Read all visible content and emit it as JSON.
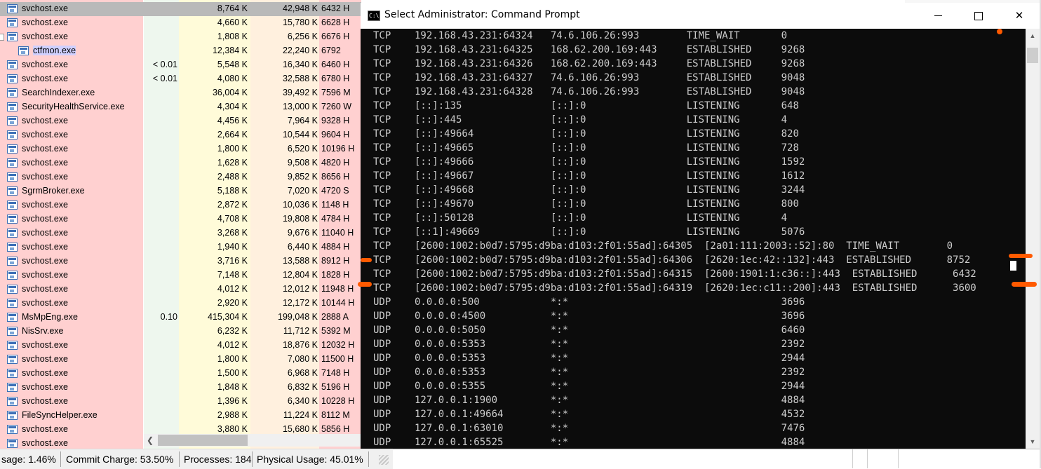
{
  "process_explorer": {
    "rows": [
      {
        "name": "svchost.exe",
        "cpu": "",
        "private": "8,764 K",
        "working": "42,948 K",
        "pid": "6432 H",
        "state": "selected"
      },
      {
        "name": "svchost.exe",
        "cpu": "",
        "private": "4,660 K",
        "working": "15,780 K",
        "pid": "6628 H"
      },
      {
        "name": "svchost.exe",
        "cpu": "",
        "private": "1,808 K",
        "working": "6,256 K",
        "pid": "6676 H",
        "expander": true
      },
      {
        "name": "ctfmon.exe",
        "cpu": "",
        "private": "12,384 K",
        "working": "22,240 K",
        "pid": "6792",
        "child": true,
        "state": "highlight"
      },
      {
        "name": "svchost.exe",
        "cpu": "< 0.01",
        "private": "5,548 K",
        "working": "16,340 K",
        "pid": "6460 H"
      },
      {
        "name": "svchost.exe",
        "cpu": "< 0.01",
        "private": "4,080 K",
        "working": "32,588 K",
        "pid": "6780 H"
      },
      {
        "name": "SearchIndexer.exe",
        "cpu": "",
        "private": "36,004 K",
        "working": "39,492 K",
        "pid": "7596 M"
      },
      {
        "name": "SecurityHealthService.exe",
        "cpu": "",
        "private": "4,304 K",
        "working": "13,000 K",
        "pid": "7260 W"
      },
      {
        "name": "svchost.exe",
        "cpu": "",
        "private": "4,456 K",
        "working": "7,964 K",
        "pid": "9328 H"
      },
      {
        "name": "svchost.exe",
        "cpu": "",
        "private": "2,664 K",
        "working": "10,544 K",
        "pid": "9604 H"
      },
      {
        "name": "svchost.exe",
        "cpu": "",
        "private": "1,800 K",
        "working": "6,520 K",
        "pid": "10196 H"
      },
      {
        "name": "svchost.exe",
        "cpu": "",
        "private": "1,628 K",
        "working": "9,508 K",
        "pid": "4820 H"
      },
      {
        "name": "svchost.exe",
        "cpu": "",
        "private": "2,488 K",
        "working": "9,852 K",
        "pid": "8656 H"
      },
      {
        "name": "SgrmBroker.exe",
        "cpu": "",
        "private": "5,188 K",
        "working": "7,020 K",
        "pid": "4720 S"
      },
      {
        "name": "svchost.exe",
        "cpu": "",
        "private": "2,872 K",
        "working": "10,036 K",
        "pid": "1148 H"
      },
      {
        "name": "svchost.exe",
        "cpu": "",
        "private": "4,708 K",
        "working": "19,808 K",
        "pid": "4784 H"
      },
      {
        "name": "svchost.exe",
        "cpu": "",
        "private": "3,268 K",
        "working": "9,676 K",
        "pid": "11040 H"
      },
      {
        "name": "svchost.exe",
        "cpu": "",
        "private": "1,940 K",
        "working": "6,440 K",
        "pid": "4884 H"
      },
      {
        "name": "svchost.exe",
        "cpu": "",
        "private": "3,716 K",
        "working": "13,588 K",
        "pid": "8912 H"
      },
      {
        "name": "svchost.exe",
        "cpu": "",
        "private": "7,148 K",
        "working": "12,804 K",
        "pid": "1828 H"
      },
      {
        "name": "svchost.exe",
        "cpu": "",
        "private": "4,012 K",
        "working": "12,012 K",
        "pid": "11948 H"
      },
      {
        "name": "svchost.exe",
        "cpu": "",
        "private": "2,920 K",
        "working": "12,172 K",
        "pid": "10144 H"
      },
      {
        "name": "MsMpEng.exe",
        "cpu": "0.10",
        "private": "415,304 K",
        "working": "199,048 K",
        "pid": "2888 A"
      },
      {
        "name": "NisSrv.exe",
        "cpu": "",
        "private": "6,232 K",
        "working": "11,712 K",
        "pid": "5392 M"
      },
      {
        "name": "svchost.exe",
        "cpu": "",
        "private": "4,012 K",
        "working": "18,876 K",
        "pid": "12032 H"
      },
      {
        "name": "svchost.exe",
        "cpu": "",
        "private": "1,800 K",
        "working": "7,080 K",
        "pid": "11500 H"
      },
      {
        "name": "svchost.exe",
        "cpu": "",
        "private": "1,500 K",
        "working": "6,968 K",
        "pid": "7148 H"
      },
      {
        "name": "svchost.exe",
        "cpu": "",
        "private": "1,848 K",
        "working": "6,832 K",
        "pid": "5196 H"
      },
      {
        "name": "svchost.exe",
        "cpu": "",
        "private": "1,396 K",
        "working": "6,340 K",
        "pid": "10228 H"
      },
      {
        "name": "FileSyncHelper.exe",
        "cpu": "",
        "private": "2,988 K",
        "working": "11,224 K",
        "pid": "8112 M"
      },
      {
        "name": "svchost.exe",
        "cpu": "",
        "private": "3,880 K",
        "working": "15,680 K",
        "pid": "5856 H"
      },
      {
        "name": "svchost.exe",
        "cpu": "",
        "private": "",
        "working": "",
        "pid": ""
      }
    ]
  },
  "status_bar": {
    "cpu_usage": "sage: 1.46%",
    "commit_charge": "Commit Charge: 53.50%",
    "processes": "Processes: 184",
    "physical_usage": "Physical Usage: 45.01%"
  },
  "cmd_window": {
    "title": "Select Administrator: Command Prompt",
    "icon_text": "C:\\",
    "controls": {
      "minimize": "minimize",
      "maximize": "maximize",
      "close": "✕"
    },
    "lines": [
      {
        "proto": "TCP",
        "local": "192.168.43.231:64324",
        "foreign": "74.6.106.26:993",
        "state": "TIME_WAIT",
        "pid": "0"
      },
      {
        "proto": "TCP",
        "local": "192.168.43.231:64325",
        "foreign": "168.62.200.169:443",
        "state": "ESTABLISHED",
        "pid": "9268"
      },
      {
        "proto": "TCP",
        "local": "192.168.43.231:64326",
        "foreign": "168.62.200.169:443",
        "state": "ESTABLISHED",
        "pid": "9268"
      },
      {
        "proto": "TCP",
        "local": "192.168.43.231:64327",
        "foreign": "74.6.106.26:993",
        "state": "ESTABLISHED",
        "pid": "9048"
      },
      {
        "proto": "TCP",
        "local": "192.168.43.231:64328",
        "foreign": "74.6.106.26:993",
        "state": "ESTABLISHED",
        "pid": "9048"
      },
      {
        "proto": "TCP",
        "local": "[::]:135",
        "foreign": "[::]:0",
        "state": "LISTENING",
        "pid": "648"
      },
      {
        "proto": "TCP",
        "local": "[::]:445",
        "foreign": "[::]:0",
        "state": "LISTENING",
        "pid": "4"
      },
      {
        "proto": "TCP",
        "local": "[::]:49664",
        "foreign": "[::]:0",
        "state": "LISTENING",
        "pid": "820"
      },
      {
        "proto": "TCP",
        "local": "[::]:49665",
        "foreign": "[::]:0",
        "state": "LISTENING",
        "pid": "728"
      },
      {
        "proto": "TCP",
        "local": "[::]:49666",
        "foreign": "[::]:0",
        "state": "LISTENING",
        "pid": "1592"
      },
      {
        "proto": "TCP",
        "local": "[::]:49667",
        "foreign": "[::]:0",
        "state": "LISTENING",
        "pid": "1612"
      },
      {
        "proto": "TCP",
        "local": "[::]:49668",
        "foreign": "[::]:0",
        "state": "LISTENING",
        "pid": "3244"
      },
      {
        "proto": "TCP",
        "local": "[::]:49670",
        "foreign": "[::]:0",
        "state": "LISTENING",
        "pid": "800"
      },
      {
        "proto": "TCP",
        "local": "[::]:50128",
        "foreign": "[::]:0",
        "state": "LISTENING",
        "pid": "4"
      },
      {
        "proto": "TCP",
        "local": "[::1]:49669",
        "foreign": "[::]:0",
        "state": "LISTENING",
        "pid": "5076"
      },
      {
        "proto": "TCP",
        "local": "[2600:1002:b0d7:5795:d9ba:d103:2f01:55ad]:64305",
        "foreign": "[2a01:111:2003::52]:80",
        "state": "TIME_WAIT",
        "pid": "0",
        "wide": true
      },
      {
        "proto": "TCP",
        "local": "[2600:1002:b0d7:5795:d9ba:d103:2f01:55ad]:64306",
        "foreign": "[2620:1ec:42::132]:443",
        "state": "ESTABLISHED",
        "pid": "8752",
        "wide": true
      },
      {
        "proto": "TCP",
        "local": "[2600:1002:b0d7:5795:d9ba:d103:2f01:55ad]:64315",
        "foreign": "[2600:1901:1:c36::]:443",
        "state": "ESTABLISHED",
        "pid": "6432",
        "wide": true
      },
      {
        "proto": "TCP",
        "local": "[2600:1002:b0d7:5795:d9ba:d103:2f01:55ad]:64319",
        "foreign": "[2620:1ec:c11::200]:443",
        "state": "ESTABLISHED",
        "pid": "3600",
        "wide": true
      },
      {
        "proto": "UDP",
        "local": "0.0.0.0:500",
        "foreign": "*:*",
        "state": "",
        "pid": "3696"
      },
      {
        "proto": "UDP",
        "local": "0.0.0.0:4500",
        "foreign": "*:*",
        "state": "",
        "pid": "3696"
      },
      {
        "proto": "UDP",
        "local": "0.0.0.0:5050",
        "foreign": "*:*",
        "state": "",
        "pid": "6460"
      },
      {
        "proto": "UDP",
        "local": "0.0.0.0:5353",
        "foreign": "*:*",
        "state": "",
        "pid": "2392"
      },
      {
        "proto": "UDP",
        "local": "0.0.0.0:5353",
        "foreign": "*:*",
        "state": "",
        "pid": "2944"
      },
      {
        "proto": "UDP",
        "local": "0.0.0.0:5353",
        "foreign": "*:*",
        "state": "",
        "pid": "2392"
      },
      {
        "proto": "UDP",
        "local": "0.0.0.0:5355",
        "foreign": "*:*",
        "state": "",
        "pid": "2944"
      },
      {
        "proto": "UDP",
        "local": "127.0.0.1:1900",
        "foreign": "*:*",
        "state": "",
        "pid": "4884"
      },
      {
        "proto": "UDP",
        "local": "127.0.0.1:49664",
        "foreign": "*:*",
        "state": "",
        "pid": "4532"
      },
      {
        "proto": "UDP",
        "local": "127.0.0.1:63010",
        "foreign": "*:*",
        "state": "",
        "pid": "7476"
      },
      {
        "proto": "UDP",
        "local": "127.0.0.1:65525",
        "foreign": "*:*",
        "state": "",
        "pid": "4884"
      }
    ]
  },
  "colors": {
    "titlebar_accent": "#44ab8c",
    "console_bg": "#0c0c0c",
    "console_fg": "#cccccc",
    "annotation": "#ff5a00",
    "service_row": "#ffd0d0",
    "selected_row": "#b9b9b9"
  }
}
